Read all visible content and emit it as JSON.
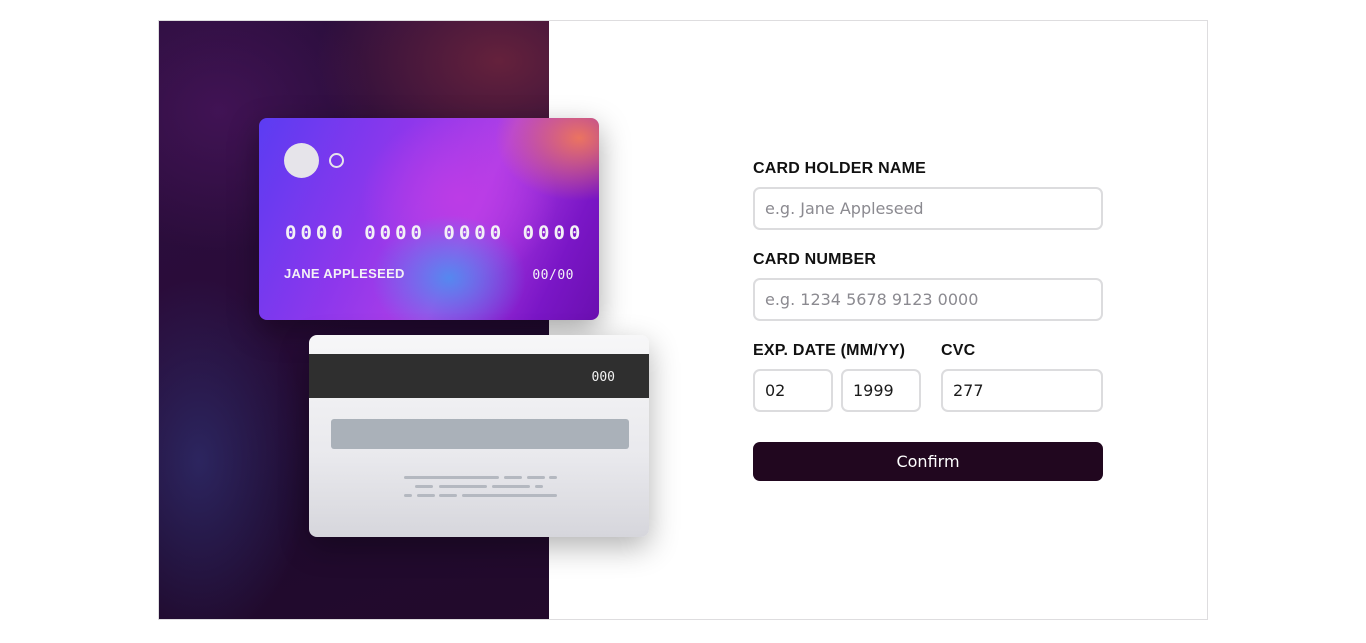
{
  "card_front": {
    "number": "0000 0000 0000 0000",
    "holder": "JANE APPLESEED",
    "expiry": "00/00"
  },
  "card_back": {
    "cvc": "000"
  },
  "form": {
    "name_label": "CARD HOLDER NAME",
    "name_placeholder": "e.g. Jane Appleseed",
    "name_value": "",
    "number_label": "CARD NUMBER",
    "number_placeholder": "e.g. 1234 5678 9123 0000",
    "number_value": "",
    "exp_label": "EXP. DATE (MM/YY)",
    "exp_month_value": "02",
    "exp_year_value": "1999",
    "cvc_label": "CVC",
    "cvc_value": "277",
    "confirm_label": "Confirm"
  },
  "colors": {
    "confirm_bg": "#21071f",
    "panel_dark": "#230a2c",
    "card_purple": "#6a0fb0"
  }
}
